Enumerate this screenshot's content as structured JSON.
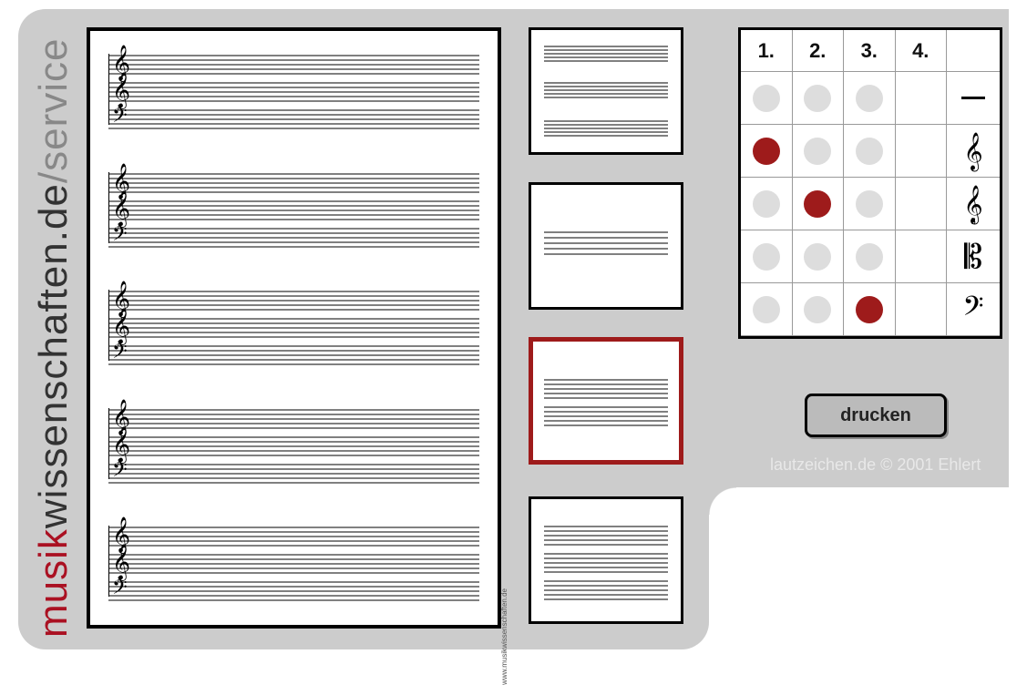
{
  "brand": {
    "part1": "musik",
    "part2": "wissenschaften.de",
    "slash": "/",
    "part3": "service"
  },
  "preview": {
    "systems_per_page": 5,
    "staves_per_system": 3,
    "clefs": [
      "treble",
      "treble8",
      "bass"
    ],
    "watermark": "www.musikwissenschaften.de"
  },
  "thumbnails": [
    {
      "id": "layout-3-gap",
      "selected": false
    },
    {
      "id": "layout-1-center",
      "selected": false
    },
    {
      "id": "layout-2-center",
      "selected": true
    },
    {
      "id": "layout-3-even",
      "selected": false
    }
  ],
  "grid": {
    "headers": [
      "1.",
      "2.",
      "3.",
      "4.",
      ""
    ],
    "rows": [
      {
        "clef_label": "—",
        "clef": "none",
        "dots": [
          "off",
          "off",
          "off",
          "blank"
        ]
      },
      {
        "clef_label": "𝄞",
        "clef": "treble",
        "dots": [
          "on",
          "off",
          "off",
          "blank"
        ]
      },
      {
        "clef_label": "𝄞",
        "clef": "treble8",
        "dots": [
          "off",
          "on",
          "off",
          "blank"
        ]
      },
      {
        "clef_label": "𝄡",
        "clef": "alto",
        "dots": [
          "off",
          "off",
          "off",
          "blank"
        ]
      },
      {
        "clef_label": "𝄢",
        "clef": "bass",
        "dots": [
          "off",
          "off",
          "on",
          "blank"
        ]
      }
    ]
  },
  "buttons": {
    "print": "drucken"
  },
  "footer": {
    "copyright": "lautzeichen.de © 2001 Ehlert"
  }
}
